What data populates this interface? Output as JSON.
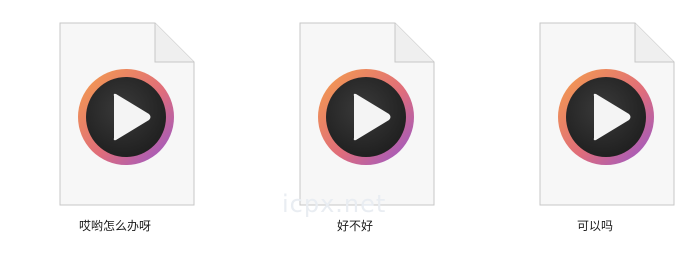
{
  "files": [
    {
      "name": "哎哟怎么办呀",
      "icon": "media-file-play-icon"
    },
    {
      "name": "好不好",
      "icon": "media-file-play-icon"
    },
    {
      "name": "可以吗",
      "icon": "media-file-play-icon"
    }
  ],
  "watermark": "icpx.net",
  "colors": {
    "ring_gradient_start": "#f39a49",
    "ring_gradient_end": "#9b5cce",
    "disc": "#262626",
    "play": "#f2f2f2"
  }
}
